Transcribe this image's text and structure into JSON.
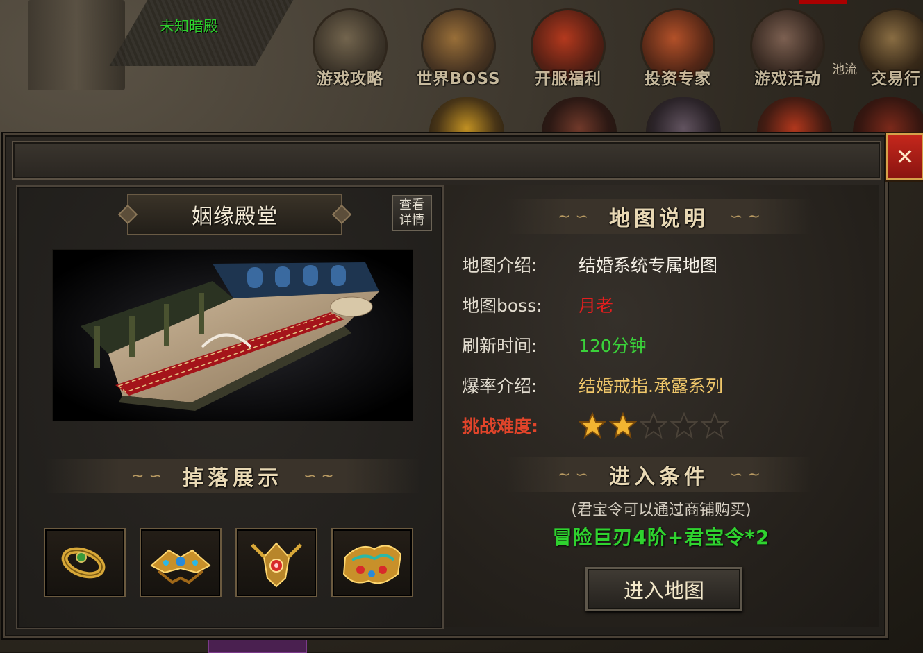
{
  "scene": {
    "area_name": "未知暗殿",
    "top_menu": [
      {
        "label": "游戏攻略"
      },
      {
        "label": "世界BOSS"
      },
      {
        "label": "开服福利"
      },
      {
        "label": "投资专家"
      },
      {
        "label": "游戏活动"
      },
      {
        "label": "交易行"
      }
    ],
    "side_text": "池流"
  },
  "dialog": {
    "close_label": "✕",
    "map_name": "姻缘殿堂",
    "detail_button": "查看详情",
    "drop_title": "掉落展示",
    "drops": [
      {
        "icon": "ring-icon"
      },
      {
        "icon": "helmet-icon"
      },
      {
        "icon": "necklace-icon"
      },
      {
        "icon": "armor-icon"
      }
    ],
    "info_title": "地图说明",
    "info": {
      "intro_label": "地图介绍:",
      "intro_value": "结婚系统专属地图",
      "boss_label": "地图boss:",
      "boss_value": "月老",
      "refresh_label": "刷新时间:",
      "refresh_value": "120分钟",
      "drop_label": "爆率介绍:",
      "drop_value": "结婚戒指.承露系列",
      "difficulty_label": "挑战难度:",
      "difficulty_stars": 2,
      "difficulty_max": 5
    },
    "entry_title": "进入条件",
    "entry_hint": "(君宝令可以通过商铺购买)",
    "entry_condition": "冒险巨刃4阶+君宝令*2",
    "enter_button": "进入地图"
  },
  "colors": {
    "boss": "#e31e1e",
    "refresh": "#3ad13a",
    "drop": "#f0c76a",
    "difficulty": "#e0442a",
    "condition": "#2fd22f"
  }
}
